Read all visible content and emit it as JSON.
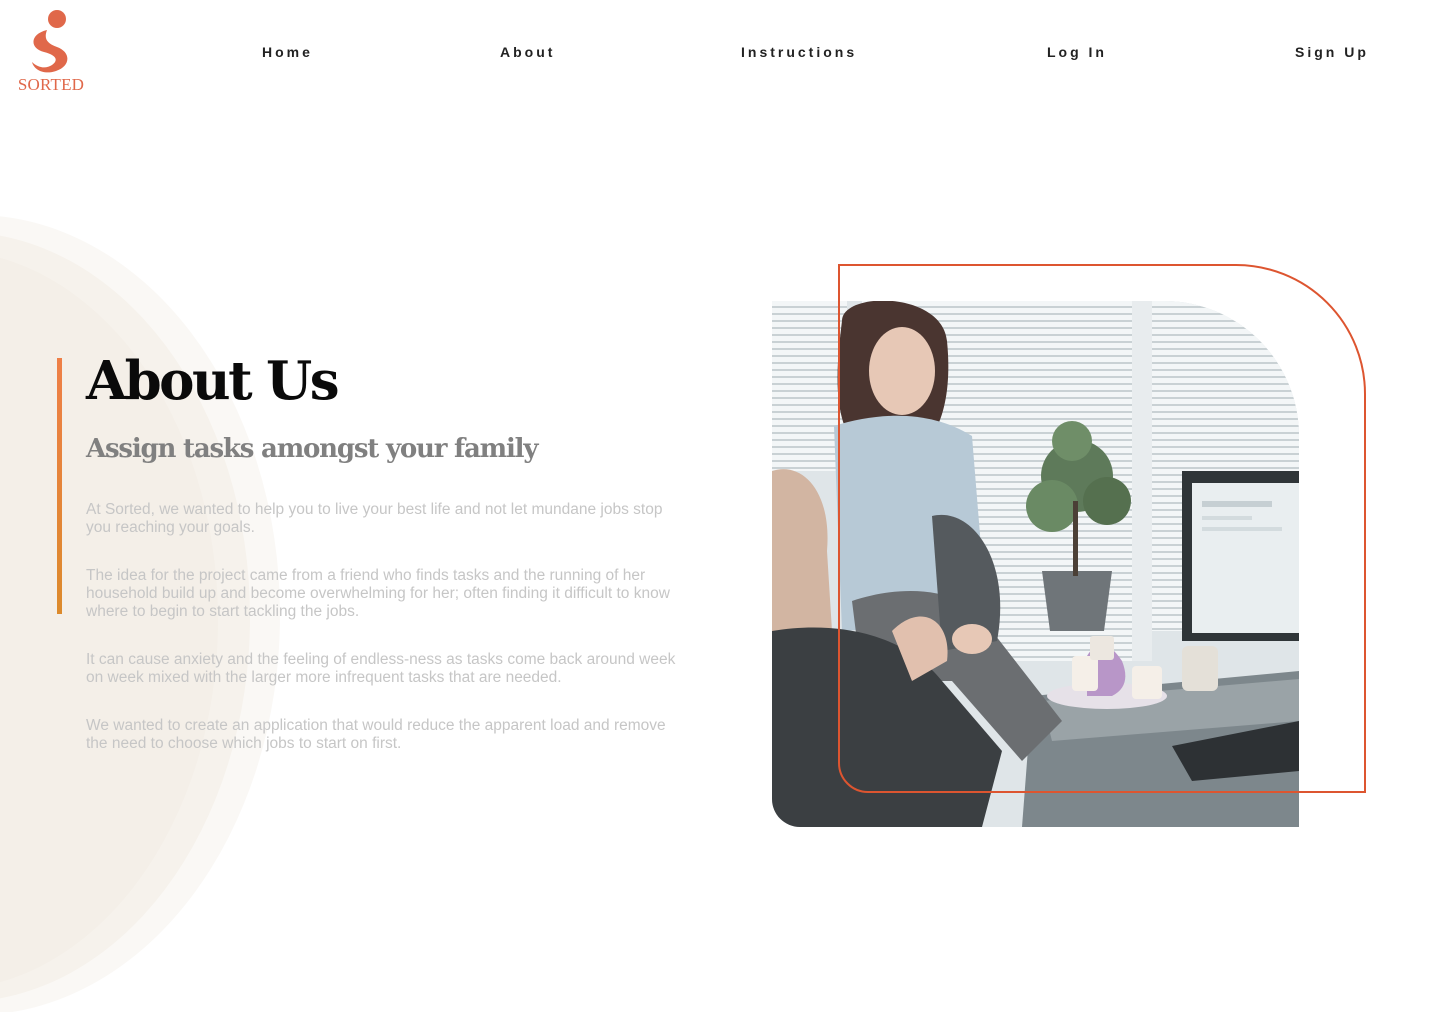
{
  "brand": {
    "logo_text": "SORTED",
    "colors": {
      "accent": "#dd5530",
      "logo": "#e0684a",
      "accent_bar": "#ee7f47"
    }
  },
  "nav": {
    "home": "Home",
    "about": "About",
    "instructions": "Instructions",
    "login": "Log In",
    "signup": "Sign Up"
  },
  "about": {
    "title": "About Us",
    "subtitle": "Assign tasks amongst your family",
    "paragraphs": [
      "At Sorted, we wanted to help you to live your best life and not let mundane jobs stop you reaching your goals.",
      "The idea for the project came from a friend who finds tasks and the running of her household build up and become overwhelming for her; often finding it difficult to know where to begin to start tackling the jobs.",
      "It can cause anxiety and the feeling of endless-ness as tasks come back around week on week mixed with the larger more infrequent tasks that are needed.",
      "We wanted to create an application that would reduce the apparent load and remove the need to choose which jobs to start on first."
    ]
  },
  "image": {
    "icon": "photo-two-people-desk"
  }
}
